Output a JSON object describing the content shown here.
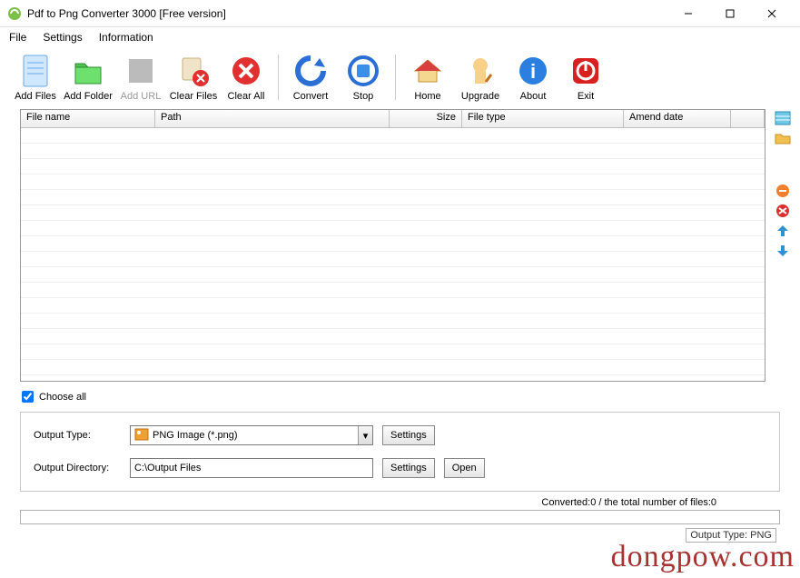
{
  "window": {
    "title": "Pdf to Png Converter 3000 [Free version]"
  },
  "menu": {
    "file": "File",
    "settings": "Settings",
    "information": "Information"
  },
  "toolbar": {
    "add_files": "Add Files",
    "add_folder": "Add Folder",
    "add_url": "Add URL",
    "clear_files": "Clear Files",
    "clear_all": "Clear All",
    "convert": "Convert",
    "stop": "Stop",
    "home": "Home",
    "upgrade": "Upgrade",
    "about": "About",
    "exit": "Exit"
  },
  "grid": {
    "cols": {
      "filename": "File name",
      "path": "Path",
      "size": "Size",
      "filetype": "File type",
      "amenddate": "Amend date"
    }
  },
  "choose_all": {
    "label": "Choose all",
    "checked": true
  },
  "output": {
    "type_label": "Output Type:",
    "type_value": "PNG Image (*.png)",
    "type_settings": "Settings",
    "dir_label": "Output Directory:",
    "dir_value": "C:\\Output Files",
    "dir_settings": "Settings",
    "dir_open": "Open"
  },
  "status": {
    "line1": "Converted:0  /  the total number of files:0",
    "line2": "Output Type: PNG"
  },
  "watermark": "dongpow.com"
}
